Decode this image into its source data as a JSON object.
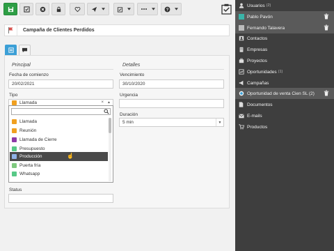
{
  "toolbar": {
    "buttons": [
      {
        "icon": "save-icon"
      },
      {
        "icon": "check-square-icon"
      },
      {
        "icon": "cancel-circle-icon"
      },
      {
        "icon": "lock-icon"
      },
      {
        "icon": "heart-icon"
      },
      {
        "icon": "send-icon"
      },
      {
        "icon": "task-icon"
      },
      {
        "icon": "more-icon"
      },
      {
        "icon": "help-icon"
      }
    ],
    "colors": {
      "save": "#2e9e45",
      "button": "#e4e4e4"
    }
  },
  "record": {
    "title": "Campaña de Clientes Perdidos",
    "flag_color": "#d9534f"
  },
  "tabs": [
    {
      "icon": "form-icon",
      "active": true
    },
    {
      "icon": "comments-icon",
      "active": false
    }
  ],
  "form": {
    "principal_header": "Principal",
    "detalles_header": "Detalles",
    "fecha_label": "Fecha de comienzo",
    "fecha_value": "20/02/2021",
    "vencimiento_label": "Vencimiento",
    "vencimiento_value": "30/10/2020",
    "tipo_label": "Tipo",
    "tipo_value": "Llamada",
    "tipo_color": "#f0a020",
    "urgencia_label": "Urgencia",
    "urgencia_value": "",
    "duracion_label": "Duración",
    "duracion_value": "5 min",
    "status_label": "Status",
    "status_value": ""
  },
  "dropdown": {
    "search_value": "",
    "highlighted_index": 5,
    "options": [
      {
        "label": "Llamada",
        "color": "#f0a020"
      },
      {
        "label": "Reunión",
        "color": "#f0a020"
      },
      {
        "label": "Llamada de Cierre",
        "color": "#8e3aa8"
      },
      {
        "label": "Presupuesto",
        "color": "#58c987"
      },
      {
        "label": "Producción",
        "color": "#8fb2e6"
      },
      {
        "label": "Puerta fría",
        "color": "#7fc97f"
      },
      {
        "label": "Whatsapp",
        "color": "#58c987"
      }
    ]
  },
  "sidebar": {
    "items": [
      {
        "label": "Usuarios",
        "count": "(2)",
        "icon": "user-icon"
      },
      {
        "label": "Pablo Pavón",
        "icon": "square-teal-icon",
        "context": true
      },
      {
        "label": "Fernando Talavera",
        "icon": "square-gray-icon",
        "context": true
      },
      {
        "label": "Contactos",
        "icon": "contacts-icon"
      },
      {
        "label": "Empresas",
        "icon": "building-icon"
      },
      {
        "label": "Proyectos",
        "icon": "briefcase-icon"
      },
      {
        "label": "Oportunidades",
        "count": "(1)",
        "icon": "opportunity-icon"
      },
      {
        "label": "Campañas",
        "icon": "megaphone-icon"
      },
      {
        "label": "Oportunidad de venta Cien SL (2)",
        "icon": "radio-icon",
        "context": true
      },
      {
        "label": "Documentos",
        "icon": "document-icon"
      },
      {
        "label": "E-mails",
        "icon": "email-icon"
      },
      {
        "label": "Productos",
        "icon": "cart-icon"
      }
    ]
  }
}
